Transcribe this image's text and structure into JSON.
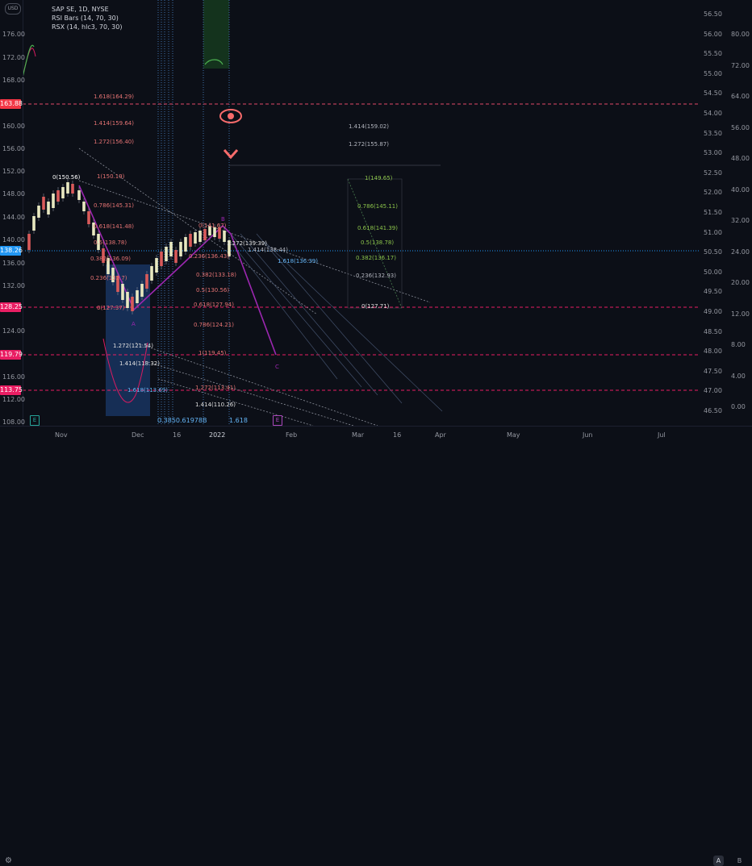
{
  "legend": {
    "symbol": "SAP SE, 1D, NYSE",
    "indicator1": "RSI Bars (14, 70, 30)",
    "indicator2": "RSX (14, hlc3, 70, 30)"
  },
  "currency_badge": "USD",
  "left_axis": [
    "176.00",
    "172.00",
    "168.00",
    "160.00",
    "156.00",
    "152.00",
    "148.00",
    "144.00",
    "140.00",
    "136.00",
    "132.00",
    "124.00",
    "116.00",
    "112.00",
    "108.00"
  ],
  "price_tags": [
    {
      "label": "163.88",
      "color": "#f23645"
    },
    {
      "label": "138.26",
      "color": "#2196f3"
    },
    {
      "label": "128.25",
      "color": "#e91e63"
    },
    {
      "label": "119.79",
      "color": "#e91e63"
    },
    {
      "label": "113.75",
      "color": "#e91e63"
    }
  ],
  "rsi_axis": [
    "56.50",
    "56.00",
    "55.50",
    "55.00",
    "54.50",
    "54.00",
    "53.50",
    "53.00",
    "52.50",
    "52.00",
    "51.50",
    "51.00",
    "50.50",
    "50.00",
    "49.50",
    "49.00",
    "48.50",
    "48.00",
    "47.50",
    "47.00",
    "46.50"
  ],
  "rsx_axis": [
    "80.00",
    "72.00",
    "64.00",
    "56.00",
    "48.00",
    "40.00",
    "32.00",
    "24.00",
    "20.00",
    "12.00",
    "8.00",
    "4.00",
    "0.00"
  ],
  "time_axis": [
    "Nov",
    "Dec",
    "16",
    "2022",
    "Feb",
    "Mar",
    "16",
    "Apr",
    "May",
    "Jun",
    "Jul"
  ],
  "fib_left": [
    "1.618(164.29)",
    "1.414(159.64)",
    "1.272(156.40)",
    "1(150.19)",
    "0.786(145.31)",
    "0.618(141.48)",
    "0.5(138.78)",
    "0.382(136.09)",
    "0.236(132.7)",
    "0(127.37)"
  ],
  "fib_mid": [
    "0(141.67)",
    "1.272(139.39)",
    "0.236(136.43)",
    "0.382(133.18)",
    "0.5(130.56)",
    "0.618(127.94)",
    "0.786(124.21)",
    "1(119.45)",
    "1.272(113.41)",
    "1.414(110.26)"
  ],
  "fib_right": [
    "1.414(159.02)",
    "1.272(155.87)",
    "1(149.65)",
    "0.786(145.11)",
    "0.618(141.39)",
    "0.5(138.78)",
    "0.382(136.17)",
    "0.236(132.93)",
    "0(127.71)"
  ],
  "fib_low": [
    "1.272(121.54)",
    "1.414(118.32)",
    "1.618(113.69)"
  ],
  "fib_other": [
    "0(150.56)",
    "1.414(138.44)",
    "1.618(136.39)",
    "1.618"
  ],
  "bottom_label": "0.3850.61978B",
  "pattern_points": [
    "A",
    "B",
    "C"
  ],
  "event_badges": [
    "E",
    "E"
  ],
  "buttons": {
    "a": "A",
    "b": "B"
  },
  "gear_icon": "⚙"
}
